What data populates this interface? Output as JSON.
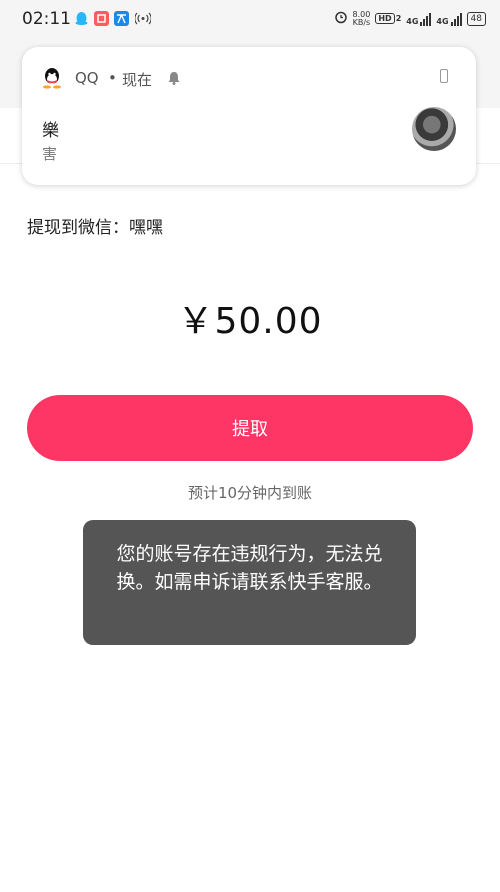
{
  "status_bar": {
    "time": "02:11",
    "network_speed_value": "8.00",
    "network_speed_unit": "KB/s",
    "hd_label": "HD",
    "hd_sub": "2",
    "signal1_label": "4G",
    "signal2_label": "4G",
    "battery": "48"
  },
  "notification": {
    "app_name": "QQ",
    "separator": "•",
    "time": "现在",
    "title": "樂",
    "body": "害"
  },
  "withdraw": {
    "destination": "提现到微信：嘿嘿",
    "amount": "￥50.00",
    "button_label": "提取",
    "eta": "预计10分钟内到账"
  },
  "toast": {
    "message": "您的账号存在违规行为，无法兑换。如需申诉请联系快手客服。"
  },
  "colors": {
    "accent": "#fe3666",
    "toast_bg": "#464646",
    "qq_icon": "#29b6f6",
    "app_icon_2": "#ff5a5f",
    "app_icon_3": "#1e88e5"
  }
}
